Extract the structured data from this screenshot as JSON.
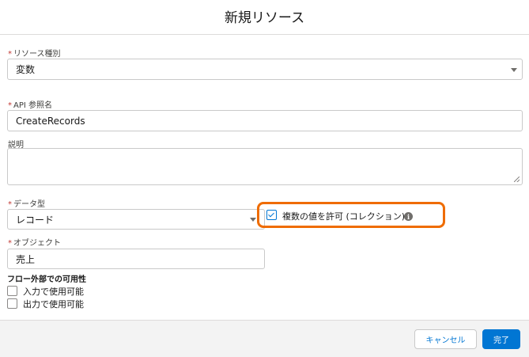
{
  "modal": {
    "title": "新規リソース"
  },
  "resource_type": {
    "label": "リソース種別",
    "value": "変数"
  },
  "api_name": {
    "label": "API 参照名",
    "value": "CreateRecords"
  },
  "description": {
    "label": "説明",
    "value": ""
  },
  "data_type": {
    "label": "データ型",
    "value": "レコード"
  },
  "allow_multiple": {
    "label": "複数の値を許可 (コレクション)",
    "checked": true,
    "info_icon": "i"
  },
  "object": {
    "label": "オブジェクト",
    "value": "売上"
  },
  "availability": {
    "title": "フロー外部での可用性",
    "input_label": "入力で使用可能",
    "output_label": "出力で使用可能"
  },
  "footer": {
    "cancel_label": "キャンセル",
    "done_label": "完了"
  },
  "required_marker": "*",
  "colors": {
    "brand": "#0176d3",
    "highlight": "#ef6c00",
    "required": "#c23934"
  }
}
